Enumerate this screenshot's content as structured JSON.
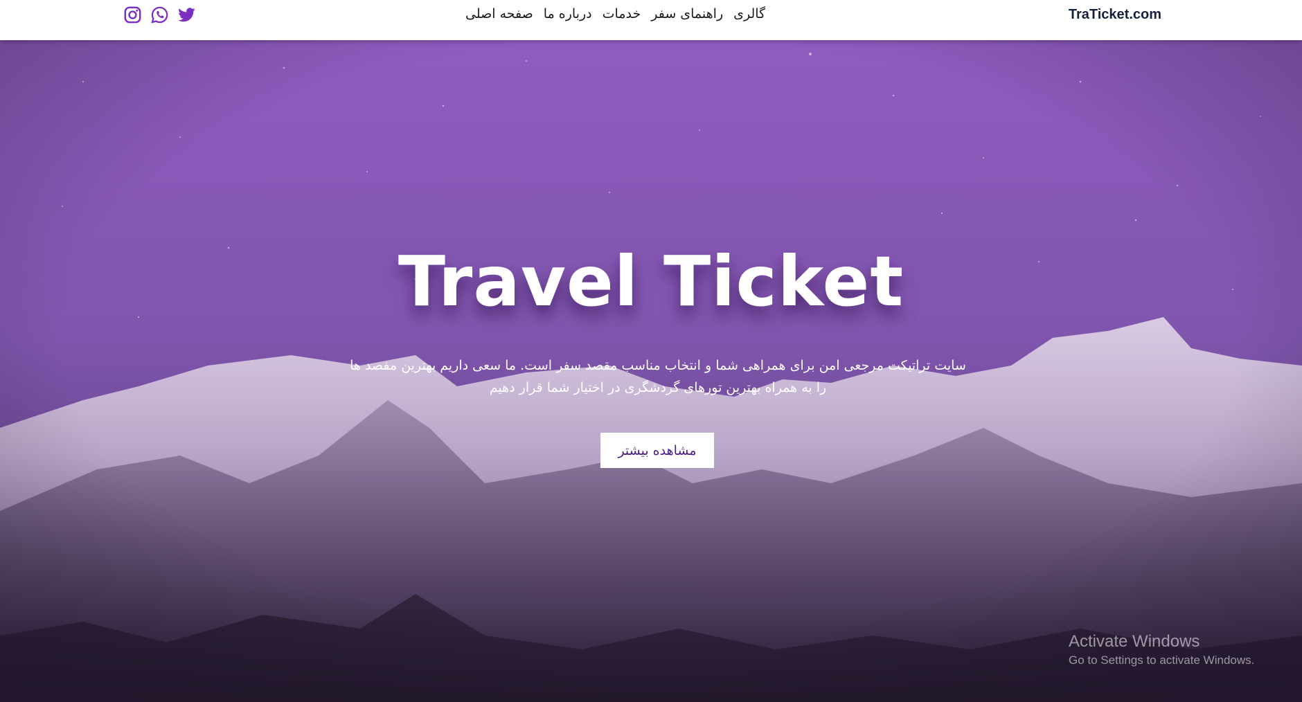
{
  "header": {
    "brand": "TraTicket.com",
    "nav_items": [
      {
        "label": "صفحه اصلی"
      },
      {
        "label": "درباره ما"
      },
      {
        "label": "خدمات"
      },
      {
        "label": "راهنمای سفر"
      },
      {
        "label": "گالری"
      }
    ],
    "social_icons": [
      "instagram-icon",
      "whatsapp-icon",
      "twitter-icon"
    ],
    "brand_color": "#14213d",
    "icon_color": "#7b2fc0"
  },
  "hero": {
    "title": "Travel Ticket",
    "text_line1": "سایت تراتیکت مرجعی امن برای همراهی شما و انتخاب مناسب مقصد سفر است. ما سعی داریم بهترین مفصد ها",
    "text_line2": "را به همراه بهترین تورهای گردشگری در اختیار شما قرار دهیم",
    "button_label": "مشاهده بیشتر",
    "overlay_color": "#8d5cc0",
    "button_text_color": "#4b1d8a"
  },
  "watermark": {
    "title": "Activate Windows",
    "subtitle": "Go to Settings to activate Windows."
  }
}
